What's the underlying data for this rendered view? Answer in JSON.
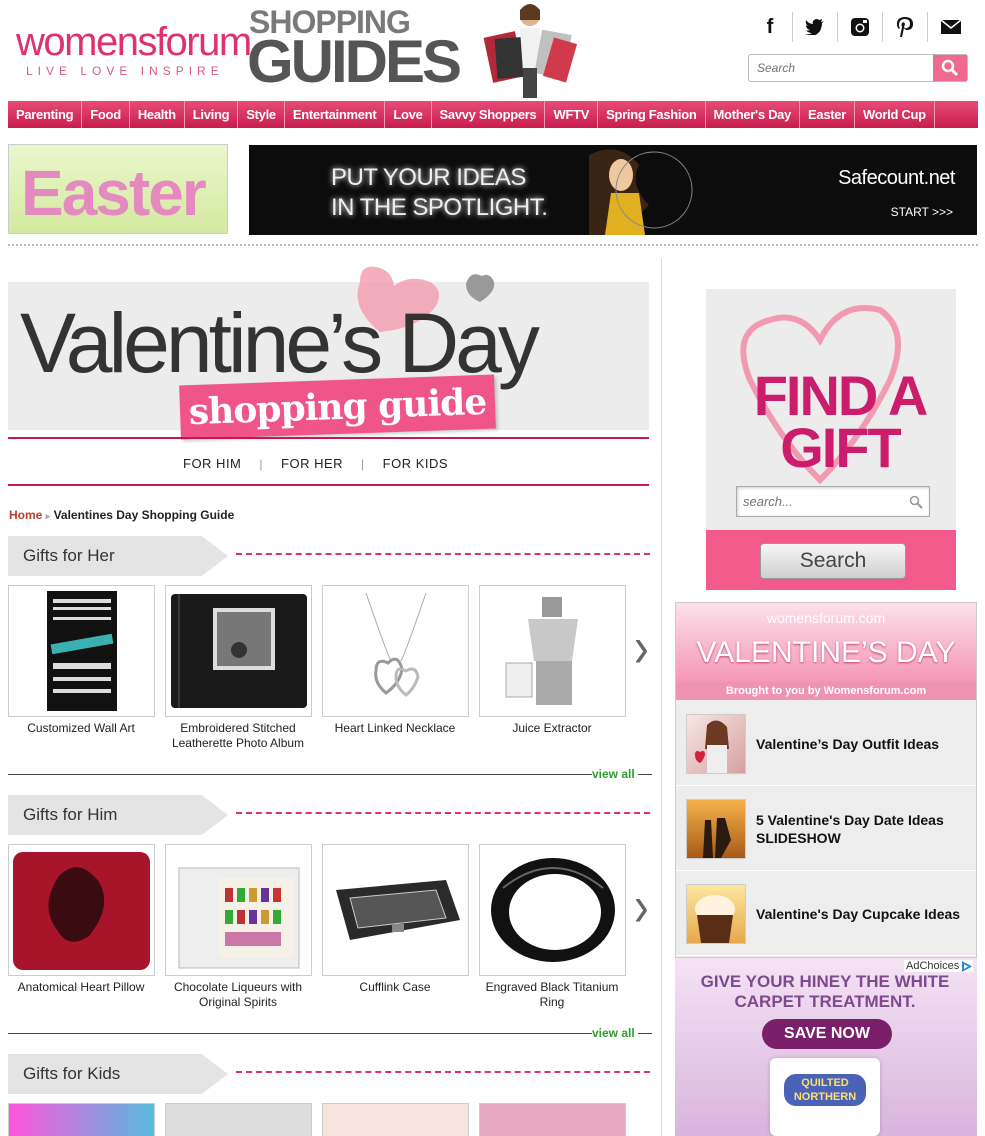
{
  "header": {
    "logo_word": "womensforum",
    "logo_tagline": "LIVE  LOVE  INSPIRE",
    "guide_small": "SHOPPING",
    "guide_big": "GUIDES",
    "search_placeholder": "Search",
    "social_icons": [
      "facebook-icon",
      "twitter-icon",
      "instagram-icon",
      "pinterest-icon",
      "email-icon"
    ]
  },
  "nav": {
    "items": [
      "Parenting",
      "Food",
      "Health",
      "Living",
      "Style",
      "Entertainment",
      "Love",
      "Savvy Shoppers",
      "WFTV",
      "Spring Fashion",
      "Mother's Day",
      "Easter",
      "World Cup"
    ]
  },
  "banners": {
    "easter_text": "Easter",
    "spot_text": "PUT YOUR IDEAS IN THE SPOTLIGHT.",
    "spot_brand": "Safecount.net",
    "spot_start": "START >>>"
  },
  "hero": {
    "title": "Valentine’s Day",
    "subtitle": "shopping guide",
    "tabs": [
      "FOR HIM",
      "FOR HER",
      "FOR KIDS"
    ]
  },
  "breadcrumb": {
    "home": "Home",
    "current": "Valentines Day Shopping Guide"
  },
  "sections": [
    {
      "title": "Gifts for Her",
      "view_all": "view all",
      "products": [
        "Customized Wall Art",
        "Embroidered Stitched Leatherette Photo Album",
        "Heart Linked Necklace",
        "Juice Extractor"
      ]
    },
    {
      "title": "Gifts for Him",
      "view_all": "view all",
      "products": [
        "Anatomical Heart Pillow",
        "Chocolate Liqueurs with Original Spirits",
        "Cufflink Case",
        "Engraved Black Titanium Ring"
      ]
    },
    {
      "title": "Gifts for Kids"
    }
  ],
  "sidebar": {
    "find_gift": "FIND A GIFT",
    "search_placeholder": "search...",
    "search_button": "Search",
    "vd_site": "womensforum.com",
    "vd_title": "VALENTINE’S DAY",
    "vd_by": "Brought to you by Womensforum.com",
    "vd_items": [
      "Valentine’s Day Outfit Ideas",
      "5 Valentine's Day Date Ideas SLIDESHOW",
      "Valentine's Day Cupcake Ideas"
    ]
  },
  "ad": {
    "choices": "AdChoices",
    "headline": "GIVE YOUR HINEY THE WHITE CARPET TREATMENT.",
    "button": "SAVE NOW",
    "product": "QUILTED NORTHERN"
  },
  "colors": {
    "brand_pink": "#e0306d",
    "nav_pink": "#d3275a",
    "view_all_green": "#2e9e2e"
  }
}
